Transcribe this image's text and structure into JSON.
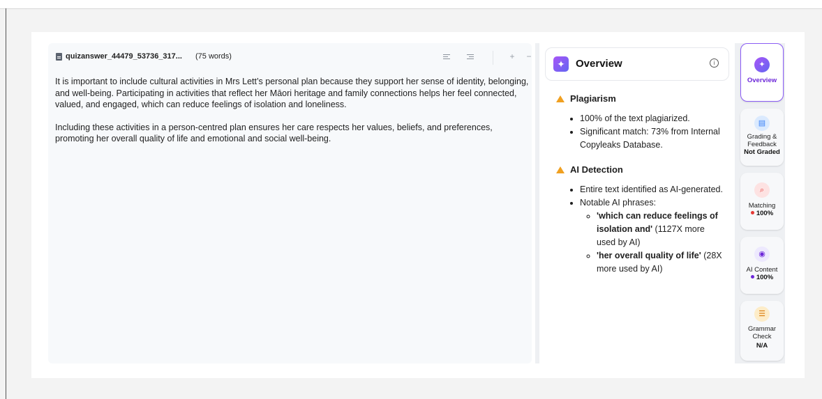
{
  "document": {
    "file_name": "quizanswer_44479_53736_317...",
    "word_count": "(75 words)",
    "paragraphs": [
      "It is important to include cultural activities in Mrs Lett’s personal plan because they support her sense of identity, belonging, and well-being. Participating in activities that reflect her Māori heritage and family connections helps her feel connected, valued, and engaged, which can reduce feelings of isolation and loneliness.",
      "Including these activities in a person-centred plan ensures her care respects her values, beliefs, and preferences, promoting her overall quality of life and emotional and social well-being."
    ],
    "toolbar": {
      "zoom_in": "+",
      "zoom_out": "−"
    }
  },
  "overview": {
    "title": "Overview",
    "info_icon": "i",
    "sections": {
      "plagiarism": {
        "title": "Plagiarism",
        "bullets": [
          "100% of the text plagiarized.",
          "Significant match: 73% from Internal Copyleaks Database."
        ]
      },
      "ai_detection": {
        "title": "AI Detection",
        "bullets": [
          "Entire text identified as AI-generated.",
          "Notable AI phrases:"
        ],
        "phrases": [
          {
            "quote": "'which can reduce feelings of isolation and'",
            "note": " (1127X more used by AI)"
          },
          {
            "quote": "'her overall quality of life'",
            "note": " (28X more used by AI)"
          }
        ]
      }
    }
  },
  "rail": {
    "overview": {
      "label": "Overview"
    },
    "grading": {
      "label": "Grading & Feedback",
      "value": "Not Graded"
    },
    "matching": {
      "label": "Matching",
      "value": "100%",
      "color": "#e53935"
    },
    "ai_content": {
      "label": "AI Content",
      "value": "100%",
      "color": "#6d28d9"
    },
    "grammar": {
      "label": "Grammar Check",
      "value": "N/A"
    }
  }
}
